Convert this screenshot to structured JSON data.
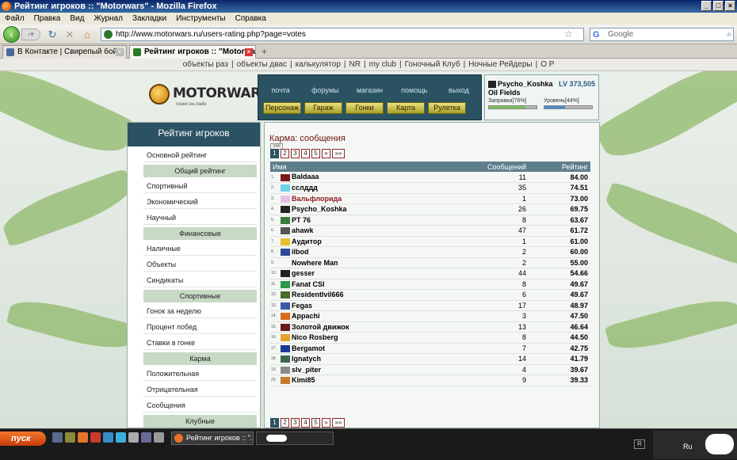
{
  "window": {
    "title": "Рейтинг игроков :: \"Motorwars\" - Mozilla Firefox"
  },
  "menu": [
    "Файл",
    "Правка",
    "Вид",
    "Журнал",
    "Закладки",
    "Инструменты",
    "Справка"
  ],
  "url": "http://www.motorwars.ru/users-rating.php?page=votes",
  "search_placeholder": "Google",
  "tabs": [
    {
      "label": "В Контакте | Свирепый бой – онлайн-..."
    },
    {
      "label": "Рейтинг игроков :: \"Motorwars\""
    }
  ],
  "bookmarks": [
    "объекты раз",
    "объекты двас",
    "калькулятор",
    "NR",
    "my club",
    "Гоночный Клуб",
    "Ночные Рейдеры",
    "О Р"
  ],
  "logo": {
    "title": "MOTORWARS.RU",
    "subtitle": "гонки он-лайн"
  },
  "nav_top": [
    "почта",
    "форумы",
    "магазин",
    "помощь",
    "выход"
  ],
  "nav_buttons": [
    "Персонаж",
    "Гараж",
    "Гонки",
    "Карта",
    "Рулетка"
  ],
  "user": {
    "name": "Psycho_Koshka",
    "level": "LV 373,505",
    "clan": "Oil Fields",
    "fuel_label": "Заправка[76%]",
    "fuel": 0.76,
    "level_label": "Уровень[44%]",
    "level_progress": 0.44
  },
  "sidebar": {
    "title": "Рейтинг игроков",
    "items": [
      {
        "label": "Основной рейтинг",
        "section": false
      },
      {
        "label": "Общий рейтинг",
        "section": true
      },
      {
        "label": "Спортивный",
        "section": false
      },
      {
        "label": "Экономический",
        "section": false
      },
      {
        "label": "Научный",
        "section": false
      },
      {
        "label": "Финансовые",
        "section": true
      },
      {
        "label": "Наличные",
        "section": false
      },
      {
        "label": "Объекты",
        "section": false
      },
      {
        "label": "Синдикаты",
        "section": false
      },
      {
        "label": "Спортивные",
        "section": true
      },
      {
        "label": "Гонок за неделю",
        "section": false
      },
      {
        "label": "Процент побед",
        "section": false
      },
      {
        "label": "Ставки в гонке",
        "section": false
      },
      {
        "label": "Карма",
        "section": true
      },
      {
        "label": "Положительная",
        "section": false
      },
      {
        "label": "Отрицательная",
        "section": false
      },
      {
        "label": "Сообщения",
        "section": false
      },
      {
        "label": "Клубные",
        "section": true
      }
    ]
  },
  "content": {
    "title": "Карма: сообщения",
    "count": "366",
    "pages": [
      "1",
      "2",
      "3",
      "4",
      "5",
      "»",
      "»»"
    ],
    "headers": [
      "Имя",
      "Сообщений",
      "Рейтинг"
    ],
    "rows": [
      {
        "n": "1.",
        "name": "Baldaaa",
        "msgs": "11",
        "rating": "84.00",
        "red": false,
        "color": "#7a1a1a"
      },
      {
        "n": "2.",
        "name": "сслддд",
        "msgs": "35",
        "rating": "74.51",
        "red": false,
        "color": "#6fd0e8"
      },
      {
        "n": "3.",
        "name": "Вальфлорида",
        "msgs": "1",
        "rating": "73.00",
        "red": true,
        "color": "#e8c0e0"
      },
      {
        "n": "4.",
        "name": "Psycho_Koshka",
        "msgs": "26",
        "rating": "69.75",
        "red": false,
        "color": "#222222"
      },
      {
        "n": "5.",
        "name": "PT 76",
        "msgs": "8",
        "rating": "63.67",
        "red": false,
        "color": "#3a7a3a"
      },
      {
        "n": "6.",
        "name": "ahawk",
        "msgs": "47",
        "rating": "61.72",
        "red": false,
        "color": "#555555"
      },
      {
        "n": "7.",
        "name": "Аудитор",
        "msgs": "1",
        "rating": "61.00",
        "red": false,
        "color": "#e8c02a"
      },
      {
        "n": "8.",
        "name": "ilbod",
        "msgs": "2",
        "rating": "60.00",
        "red": false,
        "color": "#2a4a9a"
      },
      {
        "n": "9.",
        "name": "Nowhere Man",
        "msgs": "2",
        "rating": "55.00",
        "red": false,
        "color": "#f5f7f5"
      },
      {
        "n": "10.",
        "name": "gesser",
        "msgs": "44",
        "rating": "54.66",
        "red": false,
        "color": "#222222"
      },
      {
        "n": "11.",
        "name": "Fanat CSI",
        "msgs": "8",
        "rating": "49.67",
        "red": false,
        "color": "#2a9a4a"
      },
      {
        "n": "12.",
        "name": "ResidentIvil666",
        "msgs": "6",
        "rating": "49.67",
        "red": false,
        "color": "#4a6a2a"
      },
      {
        "n": "13.",
        "name": "Fegas",
        "msgs": "17",
        "rating": "48.97",
        "red": false,
        "color": "#3a5aa8"
      },
      {
        "n": "14.",
        "name": "Appachi",
        "msgs": "3",
        "rating": "47.50",
        "red": false,
        "color": "#d86a1a"
      },
      {
        "n": "15.",
        "name": "Золотой движок",
        "msgs": "13",
        "rating": "46.64",
        "red": false,
        "color": "#6a1a1a"
      },
      {
        "n": "16.",
        "name": "Nico Rosberg",
        "msgs": "8",
        "rating": "44.50",
        "red": false,
        "color": "#e8a02a"
      },
      {
        "n": "17.",
        "name": "Bergamot",
        "msgs": "7",
        "rating": "42.75",
        "red": false,
        "color": "#1a3a9a"
      },
      {
        "n": "18.",
        "name": "Ignatych",
        "msgs": "14",
        "rating": "41.79",
        "red": false,
        "color": "#3a6a4a"
      },
      {
        "n": "19.",
        "name": "slv_piter",
        "msgs": "4",
        "rating": "39.67",
        "red": false,
        "color": "#8a8a8a"
      },
      {
        "n": "20.",
        "name": "Kimi85",
        "msgs": "9",
        "rating": "39.33",
        "red": false,
        "color": "#c87a2a"
      }
    ]
  },
  "taskbar": {
    "start": "пуск",
    "task1": "Рейтинг игроков :: \"...",
    "lang": "Ru"
  }
}
